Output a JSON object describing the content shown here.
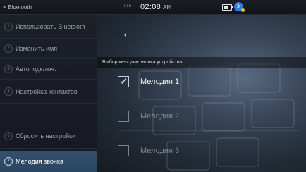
{
  "status_bar": {
    "app_label": "Bluetooth",
    "signal_label": "LTE",
    "time": "02:08",
    "ampm": "AM",
    "battery_icon": "battery-icon",
    "bluetooth_icon": "bluetooth-icon"
  },
  "sidebar": {
    "items": [
      {
        "num": "1",
        "label": "Использовать Bluetooth"
      },
      {
        "num": "2",
        "label": "Изменить имя"
      },
      {
        "num": "3",
        "label": "Автоподключ."
      },
      {
        "num": "4",
        "label": "Настройка контактов"
      },
      {
        "num": "5",
        "label": ""
      },
      {
        "num": "6",
        "label": "Сбросить настройки"
      },
      {
        "num": "7",
        "label": "Мелодия звонка"
      }
    ],
    "active_index": 6
  },
  "main": {
    "back_icon": "back-arrow-icon",
    "subtitle": "Выбор мелодии звонка устройства.",
    "options": [
      {
        "label": "Мелодия 1",
        "checked": true
      },
      {
        "label": "Мелодия 2",
        "checked": false
      },
      {
        "label": "Мелодия 3",
        "checked": false
      }
    ]
  },
  "colors": {
    "active_item": "#2f4c6b",
    "bluetooth_badge": "#2f7de1",
    "background": "#0d1015"
  }
}
